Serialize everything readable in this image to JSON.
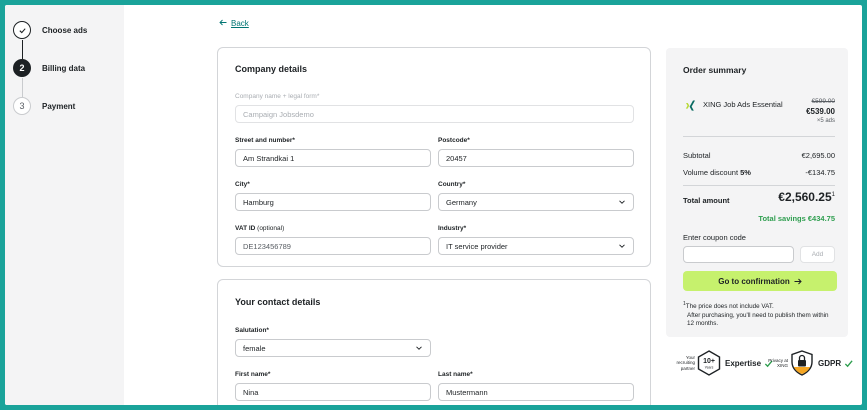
{
  "steps": [
    {
      "num": "✓",
      "label": "Choose ads"
    },
    {
      "num": "2",
      "label": "Billing data"
    },
    {
      "num": "3",
      "label": "Payment"
    }
  ],
  "back_label": "Back",
  "company": {
    "title": "Company details",
    "company_name_label": "Company name + legal form*",
    "company_name_value": "Campaign Jobsdemo",
    "street_label": "Street and number*",
    "street_value": "Am Strandkai 1",
    "postcode_label": "Postcode*",
    "postcode_value": "20457",
    "city_label": "City*",
    "city_value": "Hamburg",
    "country_label": "Country*",
    "country_value": "Germany",
    "vat_label": "VAT ID",
    "vat_optional": "(optional)",
    "vat_placeholder": "DE123456789",
    "industry_label": "Industry*",
    "industry_value": "IT service provider"
  },
  "contact": {
    "title": "Your contact details",
    "salutation_label": "Salutation*",
    "salutation_value": "female",
    "first_name_label": "First name*",
    "first_name_value": "Nina",
    "last_name_label": "Last name*",
    "last_name_value": "Mustermann"
  },
  "summary": {
    "title": "Order summary",
    "product_name": "XING Job Ads Essential",
    "old_price": "€599.00",
    "new_price": "€539.00",
    "qty": "×5 ads",
    "subtotal_label": "Subtotal",
    "subtotal_value": "€2,695.00",
    "discount_label": "Volume discount",
    "discount_pct": "5%",
    "discount_value": "-€134.75",
    "total_label": "Total amount",
    "total_value": "€2,560.25",
    "total_sup": "1",
    "savings": "Total savings €434.75",
    "coupon_label": "Enter coupon code",
    "add_label": "Add",
    "confirm_label": "Go to confirmation",
    "footnote_sup": "1",
    "footnote_line1": "The price does not include VAT.",
    "footnote_line2": "After purchasing, you'll need to publish them within 12 months."
  },
  "badges": {
    "expertise_small": "Your recruiting partner",
    "expertise_years": "10+",
    "expertise_years_sub": "Years",
    "expertise_name": "Expertise",
    "gdpr_small": "Privacy at XING",
    "gdpr_name": "GDPR"
  },
  "colors": {
    "accent_green": "#c6f16d",
    "link_teal": "#007573",
    "savings_green": "#2e9e4f",
    "frame_teal": "#1aa39a"
  }
}
